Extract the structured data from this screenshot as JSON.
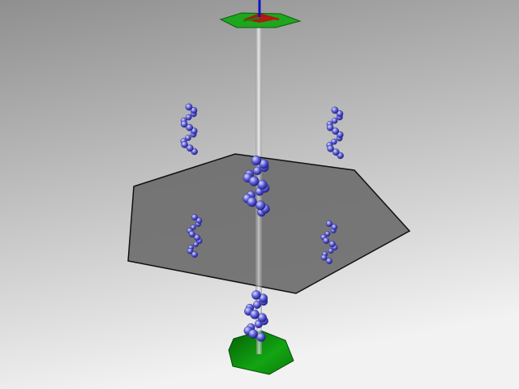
{
  "scene": {
    "background": {
      "top": "#8f8f8f",
      "bottom": "#f2f2f2"
    },
    "colors": {
      "hexagon_plate": "#6e6e6e",
      "hexagon_edge": "#111111",
      "helix_bead": "#5a5ad8",
      "helix_highlight": "#d8dcff",
      "axis_rod": "#d9d9d9",
      "top_cap": "#22aa22",
      "bottom_cap": "#0f9a0f",
      "axis_x": "#cc1111",
      "axis_y": "#118811",
      "axis_z": "#1111cc"
    },
    "objects": [
      {
        "name": "central-axis-rod"
      },
      {
        "name": "top-hexagon-cap"
      },
      {
        "name": "coordinate-axes"
      },
      {
        "name": "gray-hexagon-plate"
      },
      {
        "name": "helix-upper-left"
      },
      {
        "name": "helix-upper-right"
      },
      {
        "name": "helix-center"
      },
      {
        "name": "helix-mid-left"
      },
      {
        "name": "helix-mid-right"
      },
      {
        "name": "helix-bottom"
      },
      {
        "name": "bottom-hexagon-cap"
      }
    ]
  }
}
